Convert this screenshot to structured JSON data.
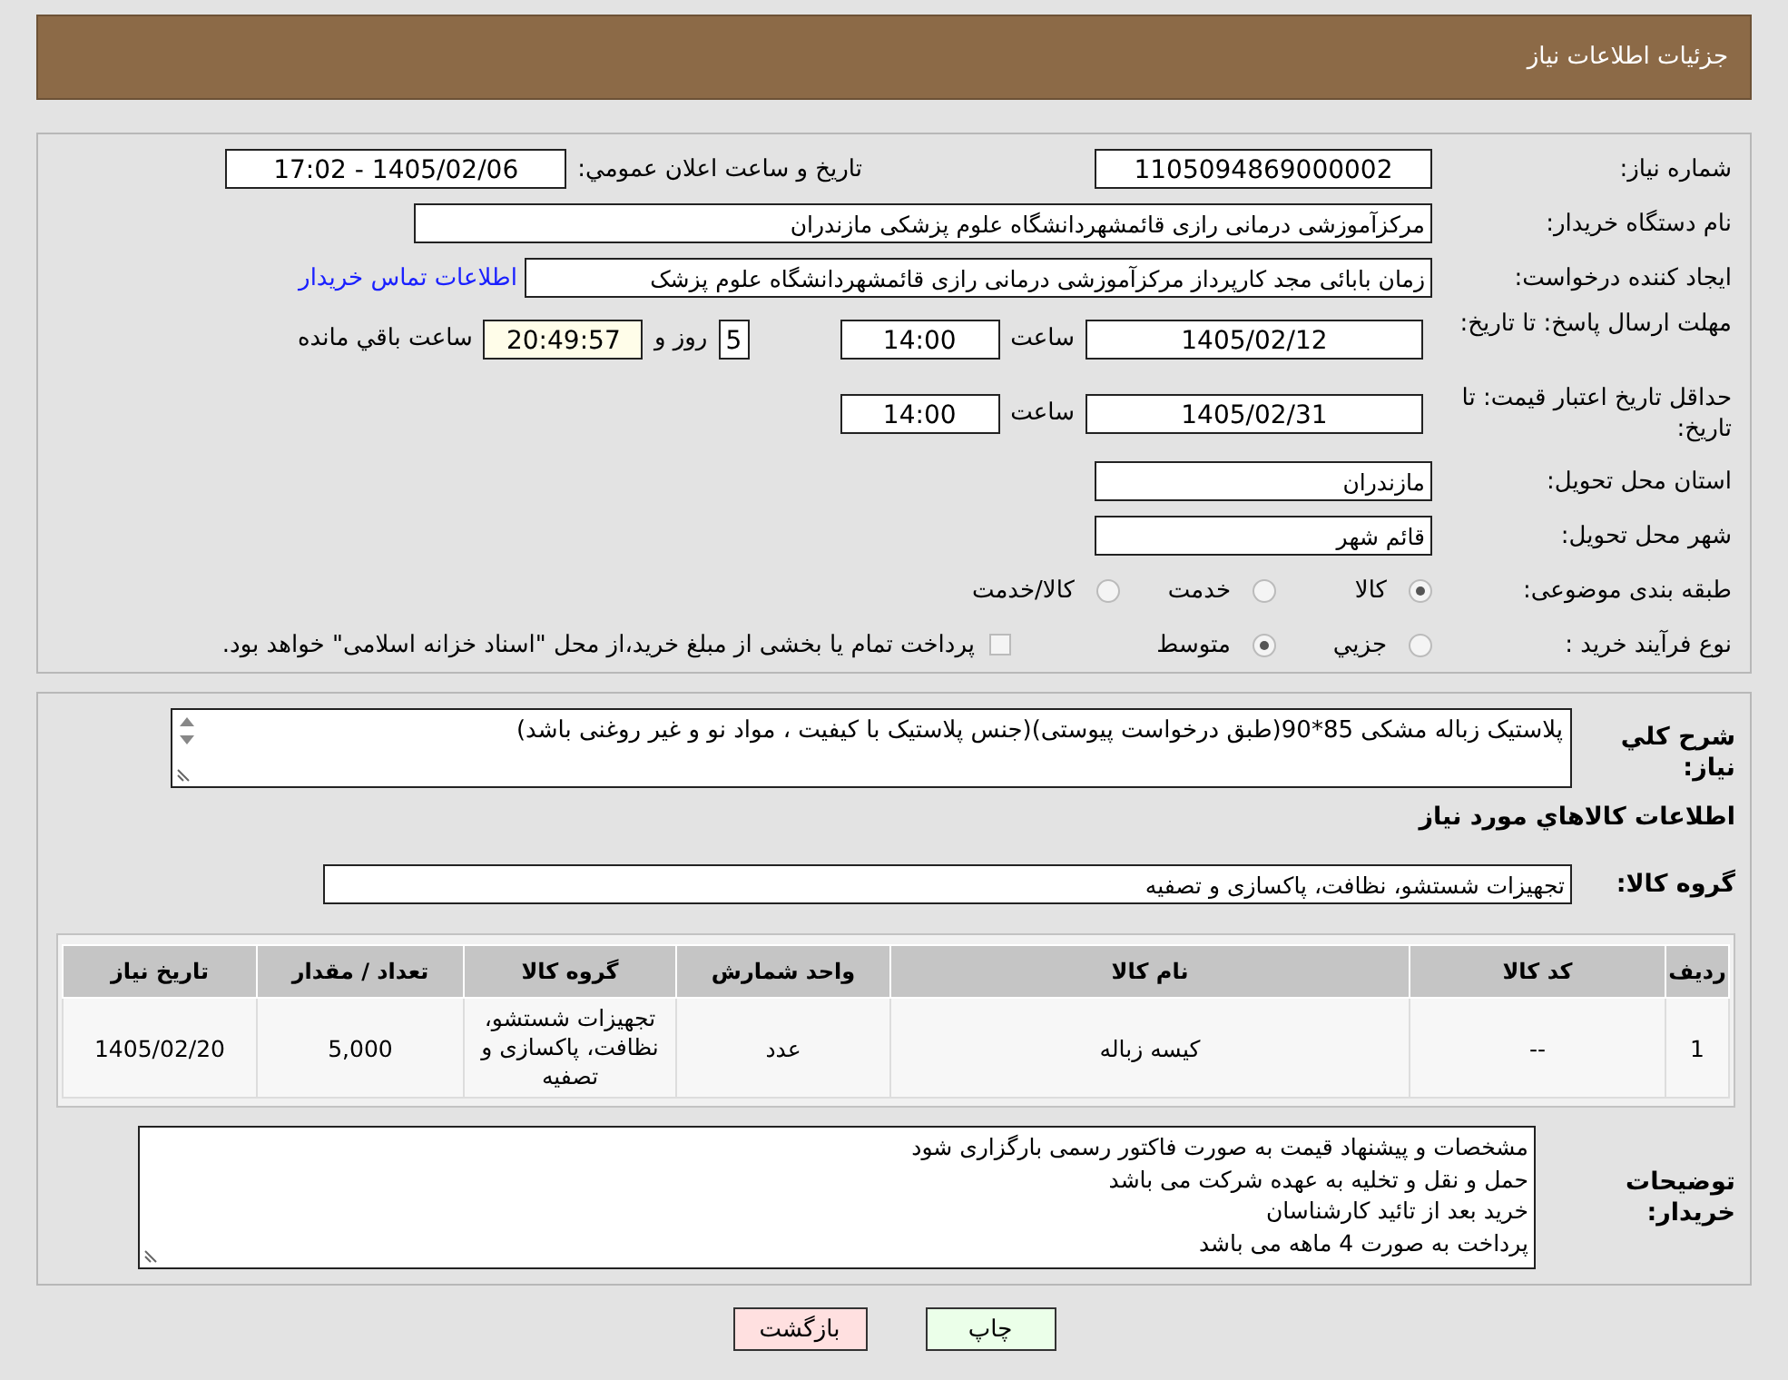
{
  "header": {
    "title": "جزئیات اطلاعات نیاز"
  },
  "details": {
    "need_number": {
      "label": "شماره نیاز:",
      "value": "1105094869000002"
    },
    "announce": {
      "label": "تاريخ و ساعت اعلان عمومي:",
      "value": "1405/02/06 - 17:02"
    },
    "buyer": {
      "label": "نام دستگاه خریدار:",
      "value": "مرکزآموزشی درمانی رازی قائمشهردانشگاه علوم پزشکی مازندران"
    },
    "creator": {
      "label": "ایجاد کننده درخواست:",
      "value": "زمان بابائی مجد کارپرداز مرکزآموزشی درمانی رازی قائمشهردانشگاه علوم پزشک",
      "link": "اطلاعات تماس خریدار"
    },
    "deadline": {
      "label": "مهلت ارسال پاسخ: تا تاریخ:",
      "date": "1405/02/12",
      "time_label": "ساعت",
      "time": "14:00",
      "days": "5",
      "days_label": "روز و",
      "remaining": "20:49:57",
      "remaining_label": "ساعت باقي مانده"
    },
    "validity": {
      "label": "حداقل تاریخ اعتبار قیمت: تا تاریخ:",
      "date": "1405/02/31",
      "time_label": "ساعت",
      "time": "14:00"
    },
    "province": {
      "label": "استان محل تحویل:",
      "value": "مازندران"
    },
    "city": {
      "label": "شهر محل تحویل:",
      "value": "قائم شهر"
    },
    "category": {
      "label": "طبقه بندی موضوعی:",
      "options": [
        {
          "label": "کالا",
          "selected": true
        },
        {
          "label": "خدمت",
          "selected": false
        },
        {
          "label": "کالا/خدمت",
          "selected": false
        }
      ]
    },
    "purchase_type": {
      "label": "نوع فرآیند خرید :",
      "options": [
        {
          "label": "جزيي",
          "selected": false
        },
        {
          "label": "متوسط",
          "selected": true
        }
      ],
      "treasury": {
        "checked": false,
        "text": "پرداخت تمام یا بخشی از مبلغ خرید،از محل \"اسناد خزانه اسلامی\" خواهد بود."
      }
    }
  },
  "description": {
    "label": "شرح کلي نياز:",
    "value": "پلاستیک زباله مشکی 85*90(طبق درخواست پیوستی)(جنس پلاستیک با کیفیت ، مواد نو و غیر روغنی باشد)"
  },
  "goods_heading": "اطلاعات کالاهاي مورد نياز",
  "goods_group": {
    "label": "گروه کالا:",
    "value": "تجهیزات شستشو، نظافت، پاکسازی و تصفیه"
  },
  "table": {
    "columns": [
      "ردیف",
      "کد کالا",
      "نام کالا",
      "واحد شمارش",
      "گروه کالا",
      "تعداد / مقدار",
      "تاریخ نیاز"
    ],
    "rows": [
      [
        "1",
        "--",
        "کیسه زباله",
        "عدد",
        "تجهیزات شستشو، نظافت، پاکسازی و تصفیه",
        "5,000",
        "1405/02/20"
      ]
    ]
  },
  "notes": {
    "label": "توضیحات خریدار:",
    "lines": [
      "مشخصات و پیشنهاد قیمت به صورت فاکتور رسمی بارگزاری شود",
      "حمل و نقل و تخلیه به عهده شرکت می باشد",
      "خرید بعد از تائید کارشناسان",
      "پرداخت به صورت 4 ماهه می باشد"
    ]
  },
  "buttons": [
    {
      "kind": "print",
      "label": "چاپ"
    },
    {
      "kind": "back",
      "label": "بازگشت"
    }
  ]
}
